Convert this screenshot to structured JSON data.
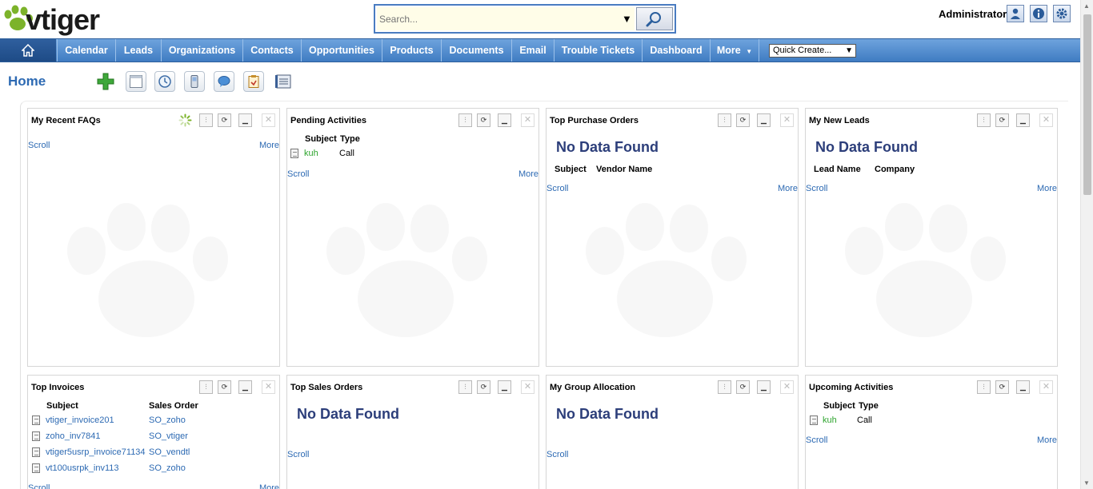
{
  "app": {
    "logo_text": "vtiger",
    "search_placeholder": "Search...",
    "user": "Administrator",
    "header_icons": [
      "user-settings-icon",
      "info-icon",
      "gear-icon"
    ]
  },
  "nav": {
    "items": [
      "Calendar",
      "Leads",
      "Organizations",
      "Contacts",
      "Opportunities",
      "Products",
      "Documents",
      "Email",
      "Trouble Tickets",
      "Dashboard",
      "More"
    ],
    "quick_create": "Quick Create..."
  },
  "home": {
    "title": "Home",
    "toolbar_icons": [
      "add-widget-icon",
      "layout-icon",
      "clock-icon",
      "phone-icon",
      "chat-icon",
      "clipboard-icon",
      "notebook-icon"
    ]
  },
  "labels": {
    "scroll": "Scroll",
    "more": "More",
    "no_data": "No Data Found"
  },
  "widgets": {
    "faqs": {
      "title": "My Recent FAQs"
    },
    "pending": {
      "title": "Pending Activities",
      "headers": [
        "Subject",
        "Type"
      ],
      "rows": [
        {
          "subject": "kuh",
          "type": "Call"
        }
      ]
    },
    "purchase": {
      "title": "Top Purchase Orders",
      "headers": [
        "Subject",
        "Vendor Name"
      ]
    },
    "leads": {
      "title": "My New Leads",
      "headers": [
        "Lead Name",
        "Company"
      ]
    },
    "invoices": {
      "title": "Top Invoices",
      "headers": [
        "Subject",
        "Sales Order"
      ],
      "rows": [
        {
          "subject": "vtiger_invoice201",
          "order": "SO_zoho"
        },
        {
          "subject": "zoho_inv7841",
          "order": "SO_vtiger"
        },
        {
          "subject": "vtiger5usrp_invoice71134",
          "order": "SO_vendtl"
        },
        {
          "subject": "vt100usrpk_inv113",
          "order": "SO_zoho"
        }
      ]
    },
    "sales": {
      "title": "Top Sales Orders"
    },
    "group": {
      "title": "My Group Allocation"
    },
    "upcoming": {
      "title": "Upcoming Activities",
      "headers": [
        "Subject",
        "Type"
      ],
      "rows": [
        {
          "subject": "kuh",
          "type": "Call"
        }
      ]
    }
  },
  "colors": {
    "nav_top": "#6ea3dd",
    "nav_bottom": "#3f7cc2",
    "link": "#2d6ab3",
    "no_data": "#2c3e7a",
    "activity_link": "#2ea42e"
  }
}
